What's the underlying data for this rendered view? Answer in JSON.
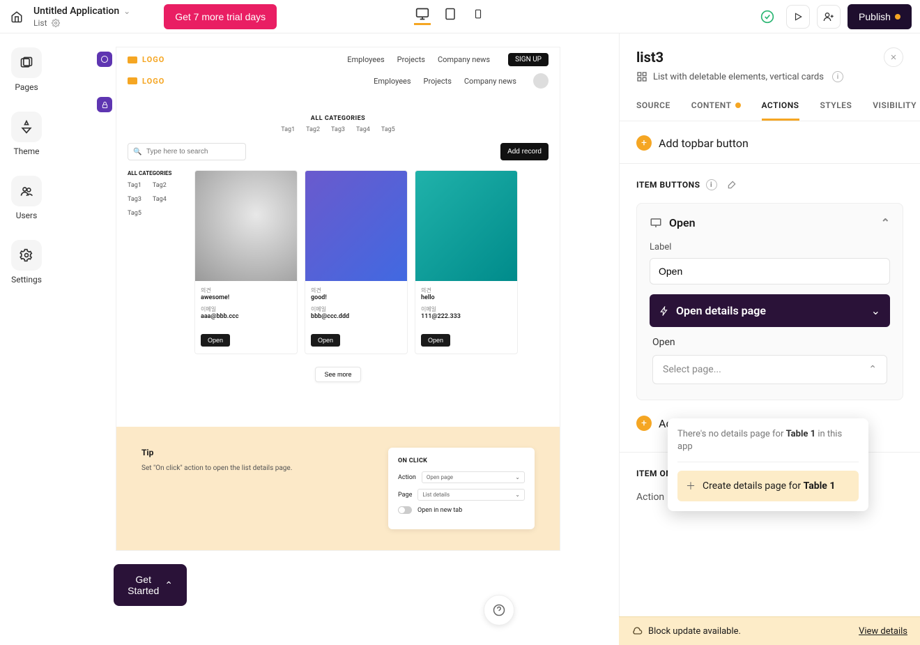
{
  "topbar": {
    "app_title": "Untitled Application",
    "page_label": "List",
    "trial_btn": "Get 7 more trial days",
    "publish": "Publish"
  },
  "leftnav": {
    "pages": "Pages",
    "theme": "Theme",
    "users": "Users",
    "settings": "Settings"
  },
  "preview": {
    "nav1": {
      "employees": "Employees",
      "projects": "Projects",
      "news": "Company news",
      "signup": "SIGN UP"
    },
    "nav2": {
      "employees": "Employees",
      "projects": "Projects",
      "news": "Company news"
    },
    "logo": "LOGO",
    "all_categories": "ALL CATEGORIES",
    "tags": [
      "Tag1",
      "Tag2",
      "Tag3",
      "Tag4",
      "Tag5"
    ],
    "search_placeholder": "Type here to search",
    "add_record": "Add record",
    "side_title": "ALL CATEGORIES",
    "side_tags": [
      "Tag1",
      "Tag2",
      "Tag3",
      "Tag4",
      "Tag5"
    ],
    "cards": [
      {
        "f1l": "의견",
        "f1v": "awesome!",
        "f2l": "이메일",
        "f2v": "aaa@bbb.ccc",
        "btn": "Open"
      },
      {
        "f1l": "의견",
        "f1v": "good!",
        "f2l": "이메일",
        "f2v": "bbb@ccc.ddd",
        "btn": "Open"
      },
      {
        "f1l": "의견",
        "f1v": "hello",
        "f2l": "이메일",
        "f2v": "111@222.333",
        "btn": "Open"
      }
    ],
    "see_more": "See more",
    "tip": {
      "title": "Tip",
      "text": "Set \"On click\" action to open the list details page.",
      "panel_title": "ON CLICK",
      "row_action": "Action",
      "sel_action": "Open page",
      "row_page": "Page",
      "sel_page": "List details",
      "open_new_tab": "Open in new tab"
    }
  },
  "right": {
    "title": "list3",
    "subtitle": "List with deletable elements, vertical cards",
    "tabs": {
      "source": "SOURCE",
      "content": "CONTENT",
      "actions": "ACTIONS",
      "styles": "STYLES",
      "visibility": "VISIBILITY"
    },
    "add_topbar_btn": "Add topbar button",
    "item_buttons_title": "ITEM BUTTONS",
    "open_card_title": "Open",
    "label_label": "Label",
    "label_value": "Open",
    "subpanel_title": "Open details page",
    "open_label": "Open",
    "select_placeholder": "Select page...",
    "add_item_btn": "Add item button",
    "item_on_click": "ITEM ON CLICK",
    "action_label": "Action"
  },
  "dropdown": {
    "text_pre": "There's no details page for ",
    "text_bold": "Table 1",
    "text_post": " in this app",
    "create_pre": "Create details page for ",
    "create_bold": "Table 1"
  },
  "footer": {
    "get_started": "Get Started",
    "update_msg": "Block update available.",
    "view_details": "View details"
  }
}
